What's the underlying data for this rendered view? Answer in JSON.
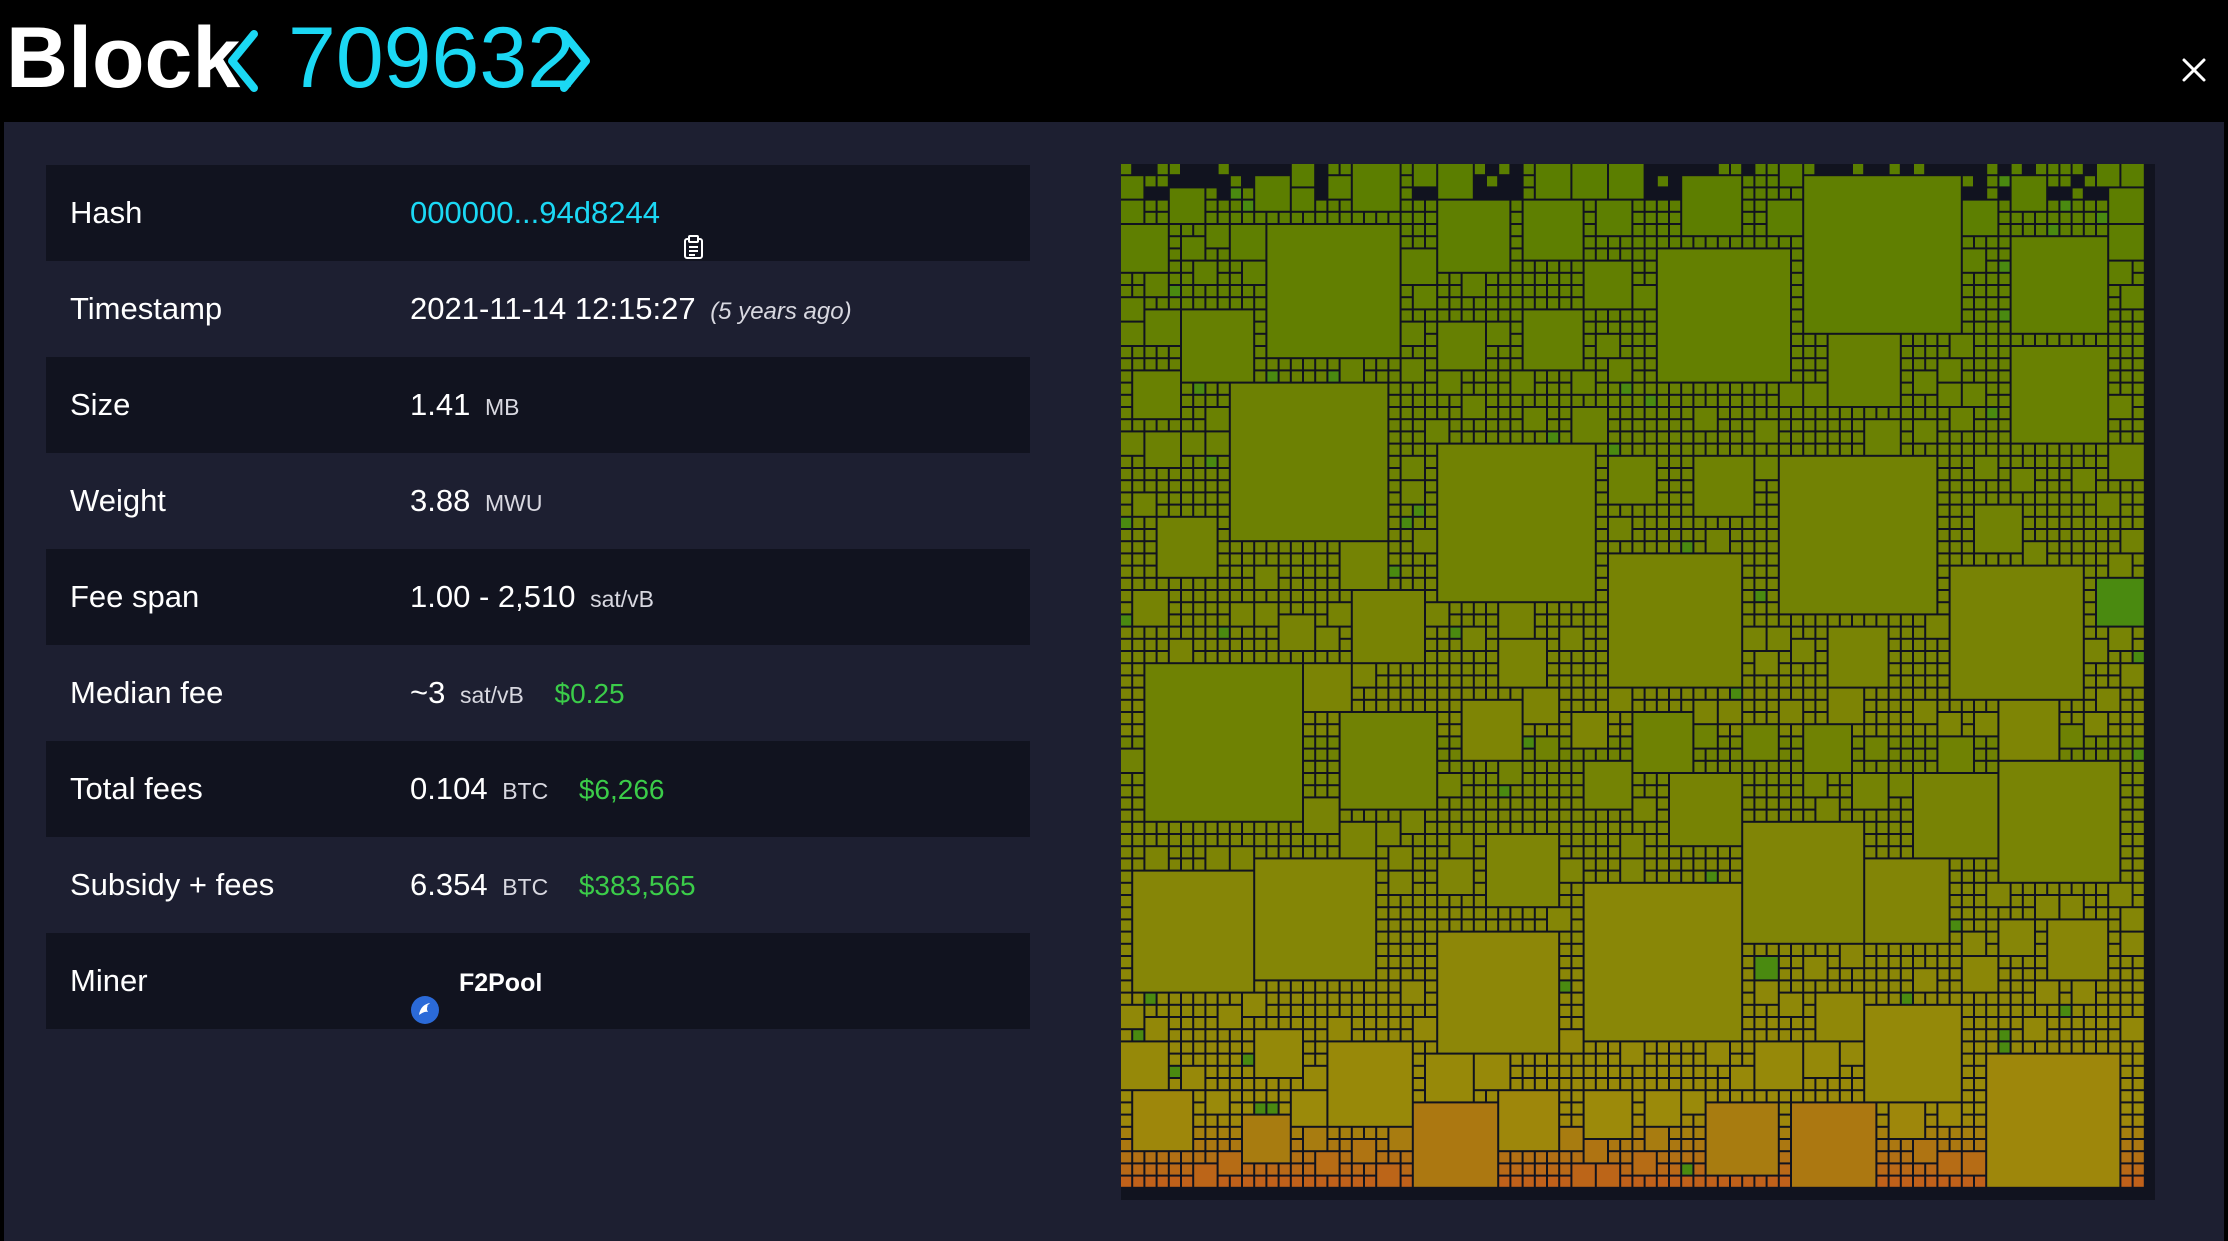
{
  "header": {
    "title": "Block",
    "block_number": "709632",
    "prev_icon": "chevron-left-icon",
    "next_icon": "chevron-right-icon",
    "close_icon": "close-icon"
  },
  "details": {
    "hash": {
      "label": "Hash",
      "value": "000000...94d8244",
      "copy_icon": "copy-icon"
    },
    "timestamp": {
      "label": "Timestamp",
      "value": "2021-11-14 12:15:27",
      "relative": "(5 years ago)"
    },
    "size": {
      "label": "Size",
      "value": "1.41",
      "unit": "MB"
    },
    "weight": {
      "label": "Weight",
      "value": "3.88",
      "unit": "MWU"
    },
    "fee_span": {
      "label": "Fee span",
      "value": "1.00 - 2,510",
      "unit": "sat/vB"
    },
    "median_fee": {
      "label": "Median fee",
      "value": "~3",
      "unit": "sat/vB",
      "fiat": "$0.25"
    },
    "total_fees": {
      "label": "Total fees",
      "value": "0.104",
      "unit": "BTC",
      "fiat": "$6,266"
    },
    "subsidy_fees": {
      "label": "Subsidy + fees",
      "value": "6.354",
      "unit": "BTC",
      "fiat": "$383,565"
    },
    "miner": {
      "label": "Miner",
      "value": "F2Pool",
      "logo_icon": "f2pool-logo-icon"
    }
  },
  "colors": {
    "accent": "#1bd8f4",
    "fiat": "#3bcc49",
    "panel_bg": "#1d1f31",
    "row_alt_bg": "#11131f",
    "low_fee": "#5a7e00",
    "mid_fee": "#9c8a0a",
    "high_fee": "#c9561e"
  }
}
